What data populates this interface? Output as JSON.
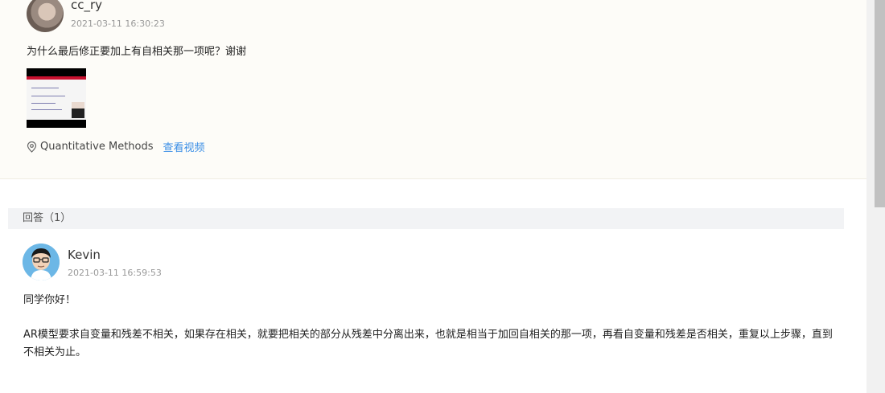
{
  "question": {
    "user": "cc_ry",
    "time": "2021-03-11 16:30:23",
    "text": "为什么最后修正要加上有自相关那一项呢？谢谢",
    "tag": "Quantitative Methods",
    "video_link": "查看视频",
    "tag_icon": "location-pin-icon"
  },
  "answers": {
    "header": "回答（1）",
    "items": [
      {
        "user": "Kevin",
        "time": "2021-03-11 16:59:53",
        "greeting": "同学你好！",
        "body": "AR模型要求自变量和残差不相关，如果存在相关，就要把相关的部分从残差中分离出来，也就是相当于加回自相关的那一项，再看自变量和残差是否相关，重复以上步骤，直到不相关为止。"
      }
    ]
  },
  "colors": {
    "link": "#3a8ee6",
    "question_bg": "#fdfcf8",
    "answers_bar_bg": "#f2f3f5"
  }
}
